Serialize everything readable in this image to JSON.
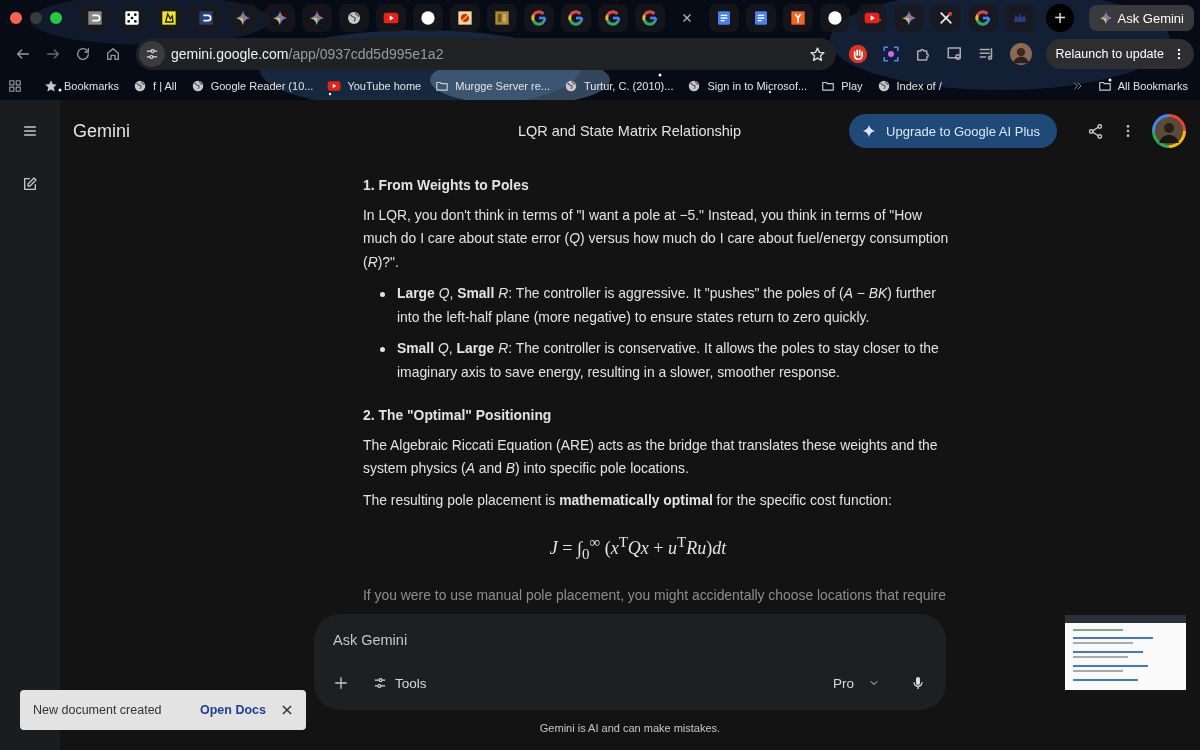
{
  "browser": {
    "tabs": [
      {
        "kind": "grey-square",
        "selected": false
      },
      {
        "kind": "dice",
        "selected": false
      },
      {
        "kind": "yellow-tile",
        "selected": false
      },
      {
        "kind": "blue-square",
        "selected": false
      },
      {
        "kind": "sparkle",
        "selected": false
      },
      {
        "kind": "sparkle",
        "selected": false
      },
      {
        "kind": "sparkle",
        "selected": false
      },
      {
        "kind": "globe",
        "selected": false
      },
      {
        "kind": "play",
        "selected": false
      },
      {
        "kind": "circle",
        "selected": false
      },
      {
        "kind": "emblem",
        "selected": false
      },
      {
        "kind": "gold-tile",
        "selected": false
      },
      {
        "kind": "g-logo",
        "selected": false
      },
      {
        "kind": "g-logo",
        "selected": false
      },
      {
        "kind": "g-logo",
        "selected": false
      },
      {
        "kind": "g-logo",
        "selected": false
      },
      {
        "selected": true
      },
      {
        "kind": "document",
        "selected": false
      },
      {
        "kind": "document",
        "selected": false
      },
      {
        "kind": "orange-tile",
        "selected": false
      },
      {
        "kind": "circle",
        "selected": false
      },
      {
        "kind": "play",
        "selected": false
      },
      {
        "kind": "sparkle",
        "selected": false
      },
      {
        "kind": "cross-logo",
        "selected": false
      },
      {
        "kind": "g-logo",
        "selected": false
      },
      {
        "kind": "crown",
        "selected": false
      }
    ],
    "new_tab": "+",
    "ask_button": "Ask Gemini",
    "url_host": "gemini.google.com",
    "url_path": "/app/0937cdd5d995e1a2",
    "relaunch_button": "Relaunch to update",
    "bookmarks": [
      {
        "label": "Bookmarks",
        "kind": "star"
      },
      {
        "label": "f | All",
        "kind": "globe"
      },
      {
        "label": "Google Reader (10...",
        "kind": "globe"
      },
      {
        "label": "YouTube home",
        "kind": "play"
      },
      {
        "label": "Murgge Server re...",
        "kind": "folder"
      },
      {
        "label": "Turtur, C. (2010)...",
        "kind": "globe"
      },
      {
        "label": "Sign in to Microsof...",
        "kind": "globe"
      },
      {
        "label": "Play",
        "kind": "folder"
      },
      {
        "label": "Index of /",
        "kind": "globe"
      }
    ],
    "all_bookmarks": "All Bookmarks"
  },
  "header": {
    "app_name": "Gemini",
    "chat_title": "LQR and State Matrix Relationship",
    "upgrade_button": "Upgrade to Google AI Plus"
  },
  "response": [
    {
      "kind": "heading",
      "text": "1. From Weights to Poles"
    },
    {
      "kind": "paragraph",
      "text": "In LQR, you don't think in terms of \"I want a pole at −5.\" Instead, you think in terms of \"How much do I care about state error (*Q*) versus how much do I care about fuel/energy consumption (*R*)?\"."
    },
    {
      "kind": "bullet",
      "text": "**Large** *Q*, **Small** *R*: The controller is aggressive. It \"pushes\" the poles of (*A* − *BK*) further into the left-half plane (more negative) to ensure states return to zero quickly."
    },
    {
      "kind": "bullet",
      "text": "**Small** *Q*, **Large** *R*: The controller is conservative. It allows the poles to stay closer to the imaginary axis to save energy, resulting in a slower, smoother response."
    },
    {
      "kind": "heading",
      "text": "2. The \"Optimal\" Positioning"
    },
    {
      "kind": "paragraph",
      "text": "The Algebraic Riccati Equation (ARE) acts as the bridge that translates these weights and the system physics (*A* and *B*) into specific pole locations."
    },
    {
      "kind": "paragraph",
      "text": "The resulting pole placement is **mathematically optimal** for the specific cost function:"
    },
    {
      "kind": "formula",
      "text": "*J* = ∫$_{0}$$^{∞}$ (*x*$^{T}$*Qx* + *u*$^{T}$*Ru*)*dt*"
    },
    {
      "kind": "paragraph",
      "faded": true,
      "text": "If you were to use manual pole placement, you might accidentally choose locations that require"
    }
  ],
  "composer": {
    "placeholder": "Ask Gemini",
    "tools_button": "Tools",
    "model_button": "Pro"
  },
  "disclaimer": "Gemini is AI and can make mistakes.",
  "toast": {
    "message": "New document created",
    "action": "Open Docs"
  }
}
